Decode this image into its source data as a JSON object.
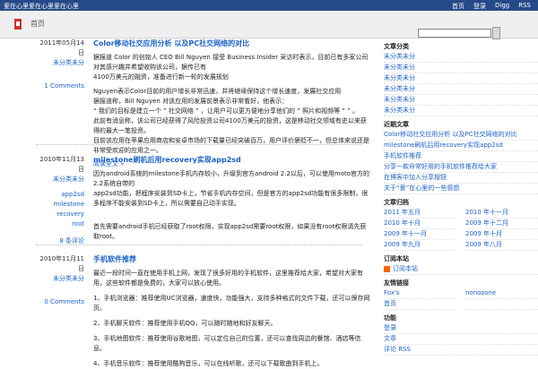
{
  "site_title": "爱在心里爱在心里爱在心里",
  "topbar_nav": [
    "首页",
    "登录",
    "Digg",
    "RSS"
  ],
  "home_title": "首页",
  "search_placeholder": "",
  "posts": [
    {
      "date": "2011年05月14日",
      "tag": "未分类未分",
      "comments": "1 Comments",
      "title": "Color移动社交应用分析 以及PC社交网络的对比",
      "paras": [
        "据报道 Color 的创始人 CEO Bill Nguyen 接受 Business Insider 采访时表示，目前已有多家公司对其感兴趣并希望收购该公司，据传已有",
        "4100万美元的融资，准备进行新一轮的发展规划",
        "Nguyen表示Color目前的用户增长非常迅速，并将继续保持这个增长速度，发展社交应用",
        "据报道称，Bill Nguyen 对该应用的发展前景表示非常看好，他表示：",
        "“ 我们的目标是建立一个 ” 社交网络 ” ，让用户可以更方便地分享他们的 ” 照片和视频等 ” ” 。",
        "此前有消息称，该公司已经获得了风险投资公司4100万美元的投资，这是移动社交领域有史以来获得的最大一笔投资。",
        "目前该应用在苹果应用商店和安卓市场的下载量已经突破百万，用户评价褒贬不一，但总体来说还是非常受欢迎的应用之一。"
      ],
      "more": "阅读全文 »"
    },
    {
      "date": "2010年11月13日",
      "tag": "未分类未分",
      "tags": [
        "app2sd",
        "milestone",
        "recovery",
        "root"
      ],
      "comments": "8 条评论",
      "title": "milestone刷机后用recovery实现app2sd",
      "paras": [
        "因为android系统的milestone手机内存较小，升级到官方android 2.2以后，可以使用moto官方的2.2系统自带的",
        "app2sd功能，把程序安装到SD卡上，节省手机内存空间，但是官方的app2sd功能有很多限制，很多程序不能安装到SD卡上，所以需要自己动手实现。",
        "首先需要android手机已经获取了root权限，实现app2sd需要root权限，如果没有root权限请先获取root。"
      ]
    },
    {
      "date": "2010年11月11日",
      "tag": "未分类未分",
      "comments": "0 Comments",
      "title": "手机软件推荐",
      "paras": [
        "最近一段时间一直在使用手机上网，发现了很多好用的手机软件，这里推荐给大家，希望对大家有用，这些软件都是免费的，大家可以放心使用。",
        "1、手机浏览器：推荐使用UC浏览器，速度快，功能强大，支持多种格式的文件下载，还可以保存网页。",
        "2、手机聊天软件：推荐使用手机QQ，可以随时随地和好友聊天。",
        "3、手机地图软件：推荐使用谷歌地图，可以定位自己的位置，还可以查找周边的餐馆、酒店等信息。",
        "4、手机音乐软件：推荐使用酷狗音乐，可以在线听歌，还可以下载歌曲到手机上。"
      ]
    }
  ],
  "sidebar": {
    "categories_head": "文章分类",
    "categories": [
      "未分类未分",
      "未分类未分",
      "未分类未分",
      "未分类未分",
      "未分类未分",
      "未分类未分"
    ],
    "recent_head": "近期文章",
    "recent": [
      "Color移动社交应用分析 以及PC社交网络的对比",
      "milestone刷机后用recovery实现app2sd",
      "手机软件推荐",
      "分享一款非常好用的手机软件推荐给大家",
      "在博客中加入分享按钮",
      "关于“爱”在心里的一些感想"
    ],
    "archive_head": "文章归档",
    "archive": [
      "2011 年五月",
      "2010 年十一月",
      "2010 年十月",
      "2009 年十二月",
      "2009 年十一月",
      "2009 年十月",
      "2009 年九月",
      "2009 年八月"
    ],
    "feed_head": "订阅本站",
    "feed_label": "订阅本站",
    "links_head": "友情链接",
    "links": [
      "Fox's",
      "nonozone",
      "首页",
      ""
    ],
    "meta_head": "功能",
    "meta": [
      "登录",
      "文章",
      "评论 RSS"
    ]
  }
}
